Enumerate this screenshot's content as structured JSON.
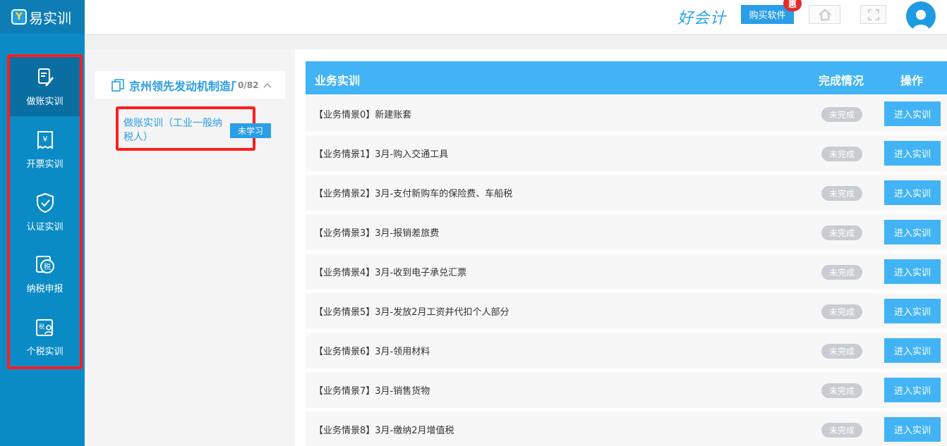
{
  "app": {
    "logo_mark": "Y",
    "logo_text": "易实训"
  },
  "sidebar": {
    "items": [
      {
        "label": "做账实训",
        "icon": "ledger-pen-icon",
        "active": true
      },
      {
        "label": "开票实训",
        "icon": "invoice-yen-icon",
        "active": false
      },
      {
        "label": "认证实训",
        "icon": "shield-check-icon",
        "active": false
      },
      {
        "label": "纳税申报",
        "icon": "tax-seal-icon",
        "active": false
      },
      {
        "label": "个税实训",
        "icon": "tax-person-icon",
        "active": false
      }
    ]
  },
  "header": {
    "brand": "好会计",
    "buy_label": "购买软件",
    "promo_badge": "惠",
    "home_icon": "home-icon",
    "fullscreen_icon": "fullscreen-icon",
    "avatar_icon": "user-avatar-icon"
  },
  "company": {
    "name": "京州领先发动机制造厂",
    "count": "0/82",
    "course": {
      "title": "做账实训（工业一般纳税人）",
      "status": "未学习"
    }
  },
  "table": {
    "headers": {
      "title": "业务实训",
      "status": "完成情况",
      "action": "操作"
    },
    "rows": [
      {
        "title": "【业务情景0】新建账套",
        "status": "未完成",
        "action": "进入实训"
      },
      {
        "title": "【业务情景1】3月-购入交通工具",
        "status": "未完成",
        "action": "进入实训"
      },
      {
        "title": "【业务情景2】3月-支付新购车的保险费、车船税",
        "status": "未完成",
        "action": "进入实训"
      },
      {
        "title": "【业务情景3】3月-报销差旅费",
        "status": "未完成",
        "action": "进入实训"
      },
      {
        "title": "【业务情景4】3月-收到电子承兑汇票",
        "status": "未完成",
        "action": "进入实训"
      },
      {
        "title": "【业务情景5】3月-发放2月工资并代扣个人部分",
        "status": "未完成",
        "action": "进入实训"
      },
      {
        "title": "【业务情景6】3月-领用材料",
        "status": "未完成",
        "action": "进入实训"
      },
      {
        "title": "【业务情景7】3月-销售货物",
        "status": "未完成",
        "action": "进入实训"
      },
      {
        "title": "【业务情景8】3月-缴纳2月增值税",
        "status": "未完成",
        "action": "进入实训"
      }
    ]
  },
  "colors": {
    "sidebar": "#0b8bc6",
    "sidebar_active": "#0a6ea3",
    "accent": "#42b4f5",
    "link": "#2a9ee6",
    "highlight_border": "#ff1e1e",
    "pill": "#c9ccd2"
  }
}
